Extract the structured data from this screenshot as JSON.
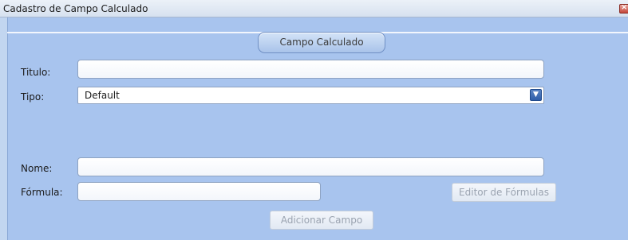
{
  "window": {
    "title": "Cadastro de Campo Calculado",
    "close_label": "×"
  },
  "header": {
    "tab_label": "Campo Calculado"
  },
  "form": {
    "titulo_label": "Titulo:",
    "titulo_value": "",
    "tipo_label": "Tipo:",
    "tipo_value": "Default",
    "nome_label": "Nome:",
    "nome_value": "",
    "formula_label": "Fórmula:",
    "formula_value": "",
    "editor_button": "Editor de Fórmulas",
    "add_button": "Adicionar Campo"
  },
  "icons": {
    "dropdown": "chevron-down-icon",
    "close": "close-icon"
  },
  "colors": {
    "panel_bg": "#a8c4ee",
    "tab_border": "#6f8fc4",
    "close_red": "#c4473b"
  }
}
